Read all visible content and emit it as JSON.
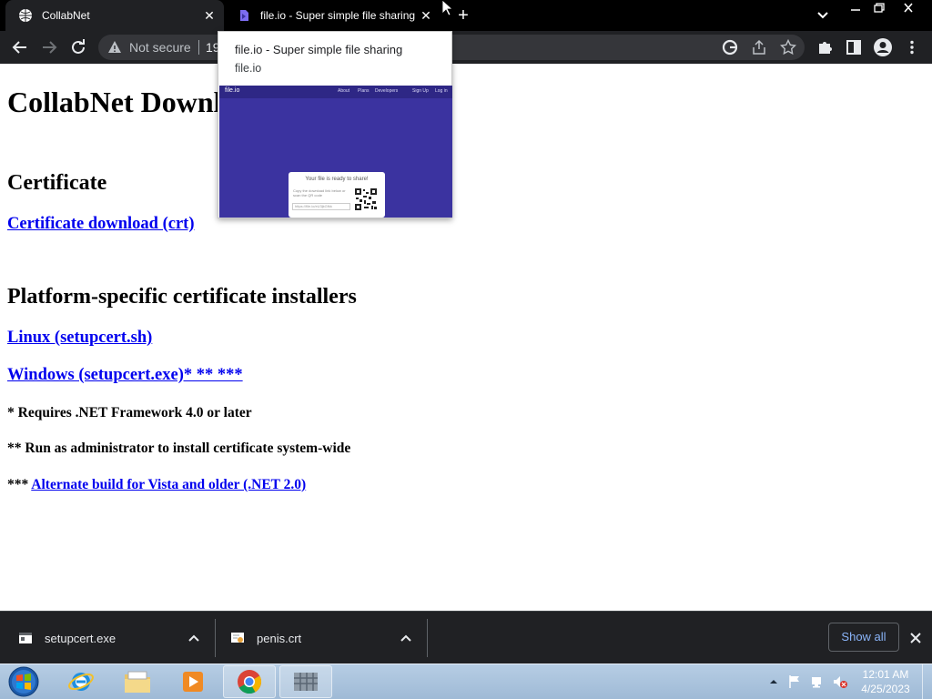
{
  "browser": {
    "tabs": [
      {
        "title": "CollabNet",
        "favicon": "globe-icon"
      },
      {
        "title": "file.io - Super simple file sharing",
        "favicon": "fileio-favicon"
      }
    ],
    "address_bar": {
      "security_text": "Not secure",
      "url_text": "19"
    }
  },
  "page": {
    "heading": "CollabNet Downl",
    "certificate_heading": "Certificate",
    "certificate_link": "Certificate download (crt)",
    "installers_heading": "Platform-specific certificate installers",
    "linux_link": "Linux (setupcert.sh)",
    "windows_link": "Windows (setupcert.exe)* ** ***",
    "note1": "* Requires .NET Framework 4.0 or later",
    "note2": "** Run as administrator to install certificate system-wide",
    "note3_prefix": "*** ",
    "note3_link": "Alternate build for Vista and older (.NET 2.0)"
  },
  "hover_card": {
    "title": "file.io - Super simple file sharing",
    "domain": "file.io",
    "preview": {
      "logo": "file.io",
      "nav_links": [
        "About",
        "Plans",
        "Developers",
        "Sign Up",
        "Log in"
      ],
      "card_title": "Your file is ready to share!",
      "card_text": "Copy the download link below or scan the QR code",
      "card_url": "https://file.io/eU3jkGfkk"
    }
  },
  "downloads": {
    "items": [
      {
        "name": "setupcert.exe",
        "icon": "exe-file-icon"
      },
      {
        "name": "penis.crt",
        "icon": "certificate-file-icon"
      }
    ],
    "show_all_label": "Show all"
  },
  "taskbar": {
    "apps": [
      "internet-explorer-icon",
      "file-explorer-icon",
      "media-player-icon",
      "chrome-icon",
      "network-icon"
    ],
    "clock_time": "12:01 AM",
    "clock_date": "4/25/2023"
  },
  "colors": {
    "link": "#0000ee",
    "browser_dark": "#202124",
    "fileio_purple": "#3b33a0",
    "showall_blue": "#8ab4f8"
  }
}
